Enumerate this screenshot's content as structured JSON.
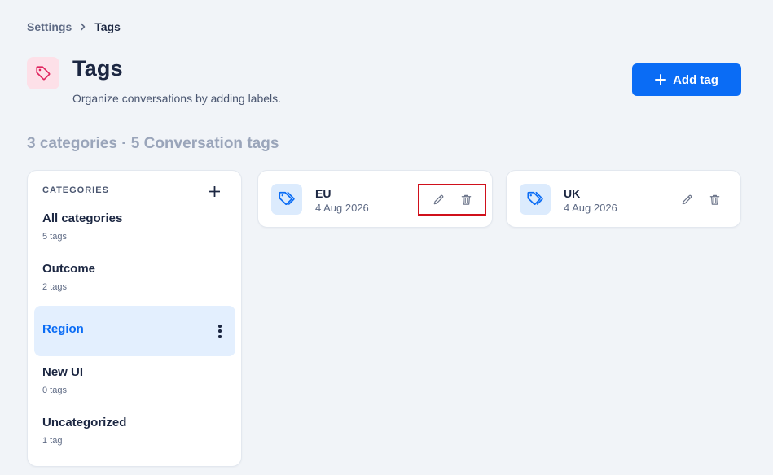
{
  "breadcrumb": {
    "parent": "Settings",
    "current": "Tags"
  },
  "header": {
    "title": "Tags",
    "subtitle": "Organize conversations by adding labels.",
    "add_button": "Add tag"
  },
  "summary": "3 categories · 5 Conversation tags",
  "categories": {
    "heading": "CATEGORIES",
    "items": [
      {
        "name": "All categories",
        "count": "5 tags"
      },
      {
        "name": "Outcome",
        "count": "2 tags"
      },
      {
        "name": "Region",
        "count": ""
      },
      {
        "name": "New UI",
        "count": "0 tags"
      },
      {
        "name": "Uncategorized",
        "count": "1 tag"
      }
    ],
    "selected": "Region"
  },
  "tags": [
    {
      "name": "EU",
      "date": "4 Aug 2026"
    },
    {
      "name": "UK",
      "date": "4 Aug 2026"
    }
  ],
  "colors": {
    "accent": "#0a6cf5",
    "highlight": "#d0101b",
    "header_icon_bg": "#fde0e8",
    "header_icon": "#e0245e"
  },
  "icons": {
    "header": "tag-icon",
    "add": "plus-icon",
    "edit": "pencil-icon",
    "delete": "trash-icon",
    "more": "kebab-icon"
  }
}
